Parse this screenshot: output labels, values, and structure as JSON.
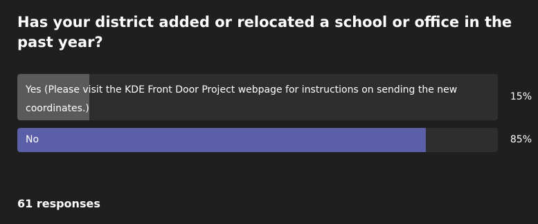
{
  "poll": {
    "question": "Has your district added or relocated a school or office in the past year?",
    "options": [
      {
        "label": "Yes (Please visit the KDE Front Door Project webpage for instructions on sending the new coordinates.)",
        "percent_label": "15%",
        "percent": 15,
        "fill_color": "#5a5a5a"
      },
      {
        "label": "No",
        "percent_label": "85%",
        "percent": 85,
        "fill_color": "#5b5fa8"
      }
    ],
    "responses_label": "61 responses"
  },
  "colors": {
    "background": "#1f1f1f",
    "track": "#2e2e2e",
    "text": "#ffffff"
  }
}
